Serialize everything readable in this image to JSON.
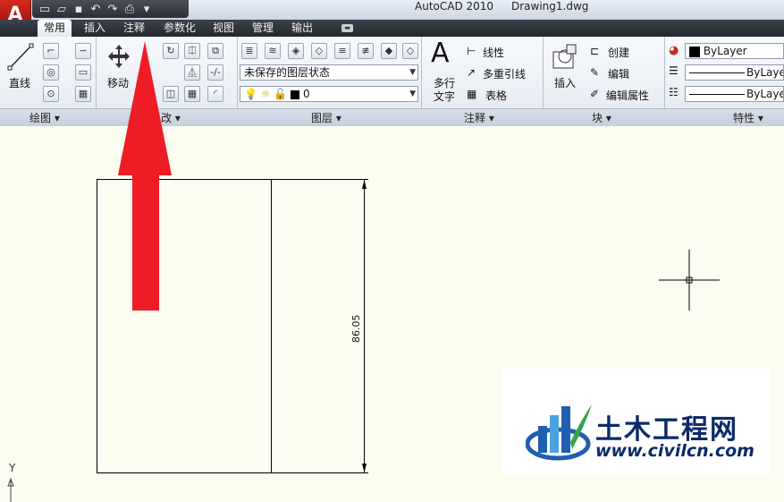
{
  "app": {
    "logo": "A",
    "title": "AutoCAD 2010",
    "document": "Drawing1.dwg"
  },
  "quick_access": [
    "new-icon",
    "open-icon",
    "save-icon",
    "undo-icon",
    "redo-icon",
    "plot-icon",
    "dropdown-icon"
  ],
  "tabs": [
    {
      "label": "常用",
      "active": true
    },
    {
      "label": "插入"
    },
    {
      "label": "注释"
    },
    {
      "label": "参数化"
    },
    {
      "label": "视图"
    },
    {
      "label": "管理"
    },
    {
      "label": "输出"
    }
  ],
  "ribbon": {
    "draw": {
      "title": "绘图 ▾",
      "line_label": "直线"
    },
    "modify": {
      "title": "改 ▾",
      "move_label": "移动"
    },
    "layers": {
      "title": "图层 ▾",
      "layer_state": "未保存的图层状态",
      "current_layer": "0"
    },
    "annotation": {
      "title": "注释 ▾",
      "mtext_label_1": "多行",
      "mtext_label_2": "文字",
      "linear_label": "线性",
      "multileader_label": "多重引线",
      "table_label": "表格"
    },
    "block": {
      "title": "块 ▾",
      "insert_label": "插入",
      "create_label": "创建",
      "edit_label": "编辑",
      "edit_attr_label": "编辑属性"
    },
    "properties": {
      "title": "特性 ▾",
      "color": "ByLayer",
      "linetype": "ByLayer",
      "lineweight": "ByLayer"
    }
  },
  "drawing": {
    "dimension_text": "86.05",
    "ucs_y_label": "Y"
  },
  "watermark": {
    "name": "土木工程网",
    "url": "www.civilcn.com"
  },
  "colors": {
    "arrow": "#ee1c25",
    "tab_bar": "#2b2f35",
    "canvas": "#fdfcf0",
    "logo_red": "#c8261c"
  }
}
